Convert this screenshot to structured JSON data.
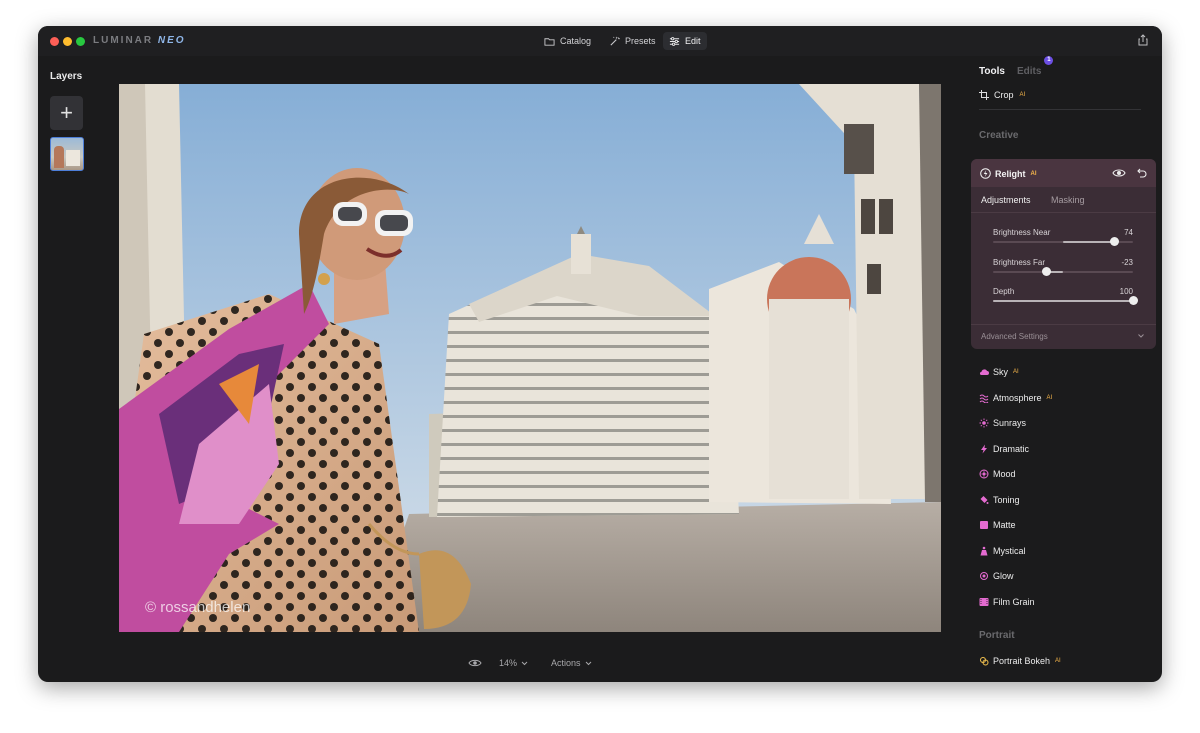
{
  "app": {
    "logo_main": "LUMINAR",
    "logo_sub": "NEO"
  },
  "nav": {
    "catalog": "Catalog",
    "presets": "Presets",
    "edit": "Edit",
    "active": "Edit"
  },
  "left": {
    "layers_title": "Layers",
    "add_symbol": "+"
  },
  "photo": {
    "watermark": "© rossandhelen"
  },
  "bottom": {
    "zoom": "14%",
    "actions": "Actions"
  },
  "right": {
    "tab_tools": "Tools",
    "tab_edits": "Edits",
    "edits_count": "1",
    "crop_label": "Crop",
    "ai_mark": "AI",
    "creative_heading": "Creative",
    "portrait_heading": "Portrait"
  },
  "relight": {
    "title": "Relight",
    "tab_adjustments": "Adjustments",
    "tab_masking": "Masking",
    "sliders": [
      {
        "label": "Brightness Near",
        "value": 74,
        "display": "74",
        "min": -100,
        "max": 100
      },
      {
        "label": "Brightness Far",
        "value": -23,
        "display": "-23",
        "min": -100,
        "max": 100
      },
      {
        "label": "Depth",
        "value": 100,
        "display": "100",
        "min": 0,
        "max": 100
      }
    ],
    "advanced": "Advanced Settings"
  },
  "tools": {
    "items": [
      {
        "label": "Sky",
        "ai": true,
        "icon": "cloud-icon",
        "color": "#e46bd0"
      },
      {
        "label": "Atmosphere",
        "ai": true,
        "icon": "waves-icon",
        "color": "#e46bd0"
      },
      {
        "label": "Sunrays",
        "ai": false,
        "icon": "sun-icon",
        "color": "#e46bd0"
      },
      {
        "label": "Dramatic",
        "ai": false,
        "icon": "bolt-icon",
        "color": "#e46bd0"
      },
      {
        "label": "Mood",
        "ai": false,
        "icon": "mood-icon",
        "color": "#e46bd0"
      },
      {
        "label": "Toning",
        "ai": false,
        "icon": "bucket-icon",
        "color": "#e46bd0"
      },
      {
        "label": "Matte",
        "ai": false,
        "icon": "square-icon",
        "color": "#e46bd0"
      },
      {
        "label": "Mystical",
        "ai": false,
        "icon": "figure-icon",
        "color": "#e46bd0"
      },
      {
        "label": "Glow",
        "ai": false,
        "icon": "glow-icon",
        "color": "#e46bd0"
      },
      {
        "label": "Film Grain",
        "ai": false,
        "icon": "film-icon",
        "color": "#e46bd0"
      }
    ],
    "portrait_items": [
      {
        "label": "Portrait Bokeh",
        "ai": true,
        "icon": "bokeh-icon",
        "color": "#f3c24f"
      }
    ]
  },
  "colors": {
    "accent": "#6c4fe3",
    "relight_panel": "#3b2d36",
    "ai_badge": "#f5b54a",
    "creative_icon": "#e46bd0"
  }
}
